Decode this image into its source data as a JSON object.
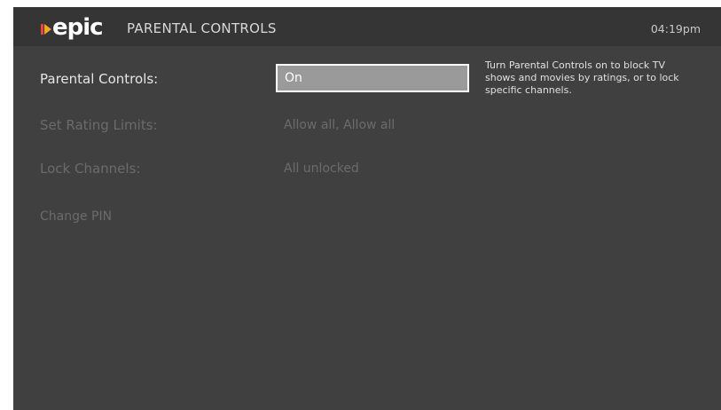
{
  "app": {
    "logo_text": "epic",
    "screen_title": "PARENTAL CONTROLS",
    "clock": "04:19pm"
  },
  "settings": {
    "parental_controls": {
      "label": "Parental Controls:",
      "value": "On"
    },
    "rating_limits": {
      "label": "Set Rating Limits:",
      "value": "Allow all, Allow all"
    },
    "lock_channels": {
      "label": "Lock Channels:",
      "value": "All unlocked"
    },
    "change_pin": {
      "label": "Change PIN"
    }
  },
  "help_text": "Turn Parental Controls on to block TV shows and movies by ratings, or to lock specific channels.",
  "colors": {
    "background": "#404040",
    "header": "#353535",
    "logo_mark_red": "#e8453c",
    "logo_mark_orange": "#f5a623",
    "focus_fill": "#9a9a9a",
    "focus_border": "#ffffff",
    "disabled_text": "#6b6b6b"
  }
}
